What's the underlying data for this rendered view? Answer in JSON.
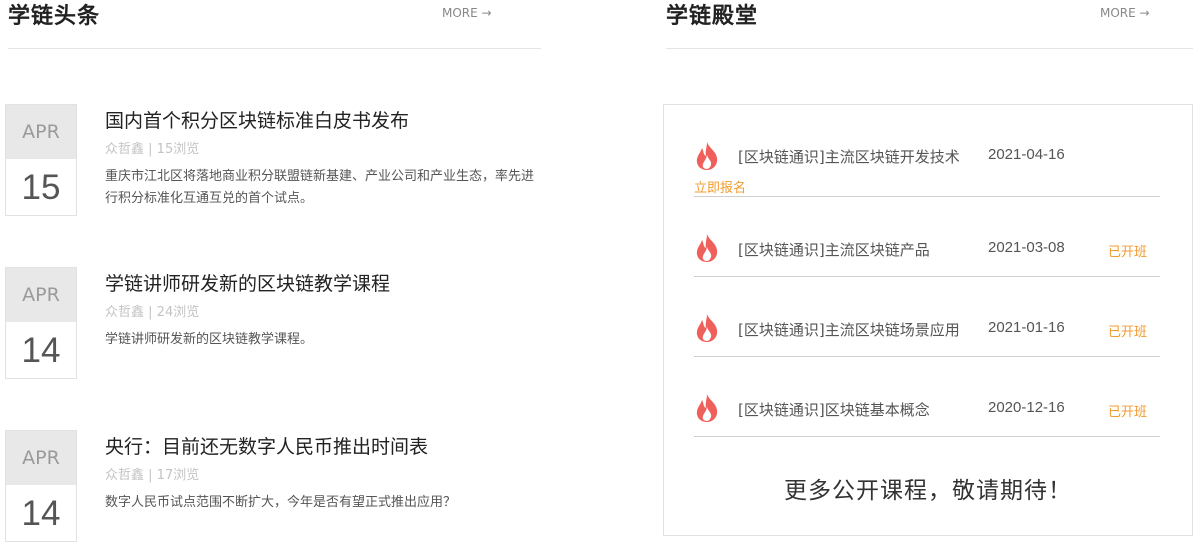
{
  "news_section": {
    "title": "学链头条",
    "more_label": "MORE →",
    "items": [
      {
        "month": "APR",
        "day": "15",
        "title": "国内首个积分区块链标准白皮书发布",
        "author": "众哲鑫",
        "views": "15浏览",
        "desc": "重庆市江北区将落地商业积分联盟链新基建、产业公司和产业生态，率先进行积分标准化互通互兑的首个试点。"
      },
      {
        "month": "APR",
        "day": "14",
        "title": "学链讲师研发新的区块链教学课程",
        "author": "众哲鑫",
        "views": "24浏览",
        "desc": "学链讲师研发新的区块链教学课程。"
      },
      {
        "month": "APR",
        "day": "14",
        "title": "央行：目前还无数字人民币推出时间表",
        "author": "众哲鑫",
        "views": "17浏览",
        "desc": "数字人民币试点范围不断扩大，今年是否有望正式推出应用？"
      }
    ]
  },
  "course_section": {
    "title": "学链殿堂",
    "more_label": "MORE →",
    "items": [
      {
        "title": "[区块链通识]主流区块链开发技术",
        "date": "2021-04-16",
        "status": "",
        "signup": "立即报名",
        "icon": "fire-icon"
      },
      {
        "title": "[区块链通识]主流区块链产品",
        "date": "2021-03-08",
        "status": "已开班",
        "signup": "",
        "icon": "fire-icon"
      },
      {
        "title": "[区块链通识]主流区块链场景应用",
        "date": "2021-01-16",
        "status": "已开班",
        "signup": "",
        "icon": "fire-icon"
      },
      {
        "title": "[区块链通识]区块链基本概念",
        "date": "2020-12-16",
        "status": "已开班",
        "signup": "",
        "icon": "fire-icon"
      }
    ],
    "footer_note": "更多公开课程，敬请期待！"
  },
  "colors": {
    "accent": "#f29b2f",
    "fire": "#f0605a",
    "date_month_bg": "#e8e8e8"
  }
}
